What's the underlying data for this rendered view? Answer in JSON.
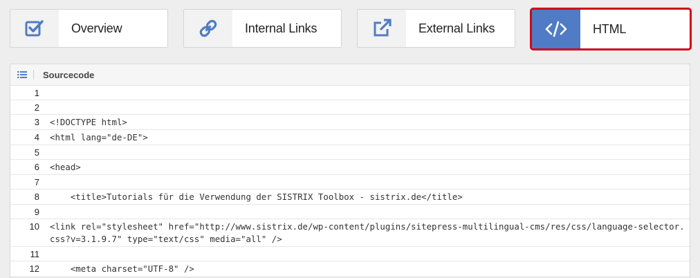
{
  "tabs": [
    {
      "label": "Overview",
      "icon": "checkbox-icon",
      "active": false
    },
    {
      "label": "Internal Links",
      "icon": "link-icon",
      "active": false
    },
    {
      "label": "External Links",
      "icon": "external-link-icon",
      "active": false
    },
    {
      "label": "HTML",
      "icon": "code-icon",
      "active": true
    }
  ],
  "panel": {
    "title": "Sourcecode",
    "icon": "list-icon"
  },
  "source_lines": [
    {
      "num": "1",
      "code": ""
    },
    {
      "num": "2",
      "code": ""
    },
    {
      "num": "3",
      "code": "<!DOCTYPE html>"
    },
    {
      "num": "4",
      "code": "<html lang=\"de-DE\">"
    },
    {
      "num": "5",
      "code": ""
    },
    {
      "num": "6",
      "code": "<head>"
    },
    {
      "num": "7",
      "code": ""
    },
    {
      "num": "8",
      "code": "    <title>Tutorials für die Verwendung der SISTRIX Toolbox - sistrix.de</title>"
    },
    {
      "num": "9",
      "code": ""
    },
    {
      "num": "10",
      "code": "<link rel=\"stylesheet\" href=\"http://www.sistrix.de/wp-content/plugins/sitepress-multilingual-cms/res/css/language-selector.css?v=3.1.9.7\" type=\"text/css\" media=\"all\" />"
    },
    {
      "num": "11",
      "code": ""
    },
    {
      "num": "12",
      "code": "    <meta charset=\"UTF-8\" />"
    }
  ],
  "colors": {
    "accent": "#4f7cc4",
    "highlight_border": "#d0021b"
  }
}
